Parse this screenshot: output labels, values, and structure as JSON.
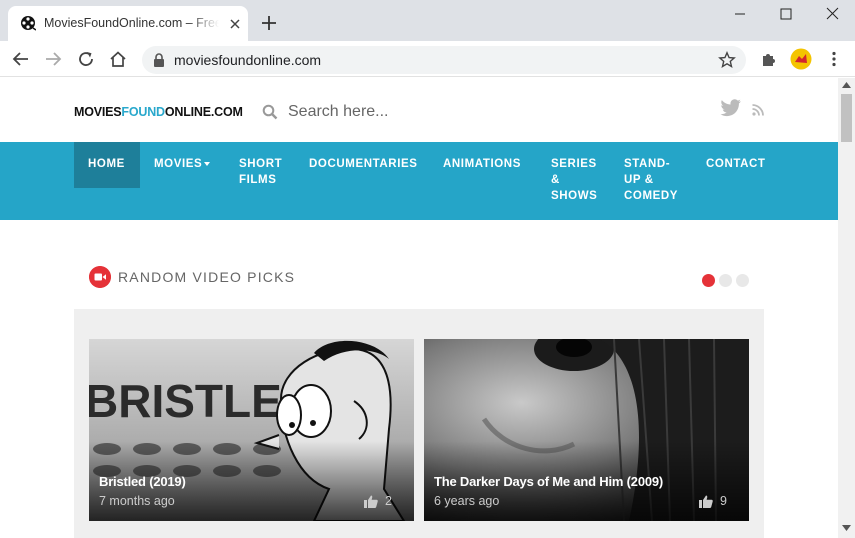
{
  "browser": {
    "tab_title": "MoviesFoundOnline.com – Free M",
    "url": "moviesfoundonline.com"
  },
  "site": {
    "logo_part1": "MOVIES",
    "logo_part2": "FOUND",
    "logo_part3": "ONLINE.COM",
    "search_placeholder": "Search here...",
    "accent_color": "#25a5c8",
    "nav": [
      {
        "label": "HOME"
      },
      {
        "label": "MOVIES"
      },
      {
        "label": "SHORT FILMS"
      },
      {
        "label": "DOCUMENTARIES"
      },
      {
        "label": "ANIMATIONS"
      },
      {
        "label": "SERIES & SHOWS"
      },
      {
        "label": "STAND-UP & COMEDY"
      },
      {
        "label": "CONTACT"
      }
    ]
  },
  "picks": {
    "title": "RANDOM VIDEO PICKS",
    "cards": [
      {
        "title": "Bristled (2019)",
        "time": "7 months ago",
        "likes": "2",
        "thumb_text": "BRISTLED"
      },
      {
        "title": "The Darker Days of Me and Him (2009)",
        "time": "6 years ago",
        "likes": "9"
      }
    ]
  }
}
